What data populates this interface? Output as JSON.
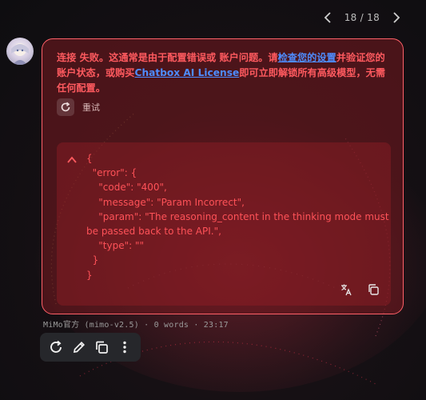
{
  "pager": {
    "text": "18 / 18"
  },
  "error": {
    "line1_pre": "连接 失败。这通常是由于配置错误或 账户问题。请",
    "settings_link": "检查您的设置",
    "line1_post": "并验证您的",
    "line2_pre": "账户状态，或购买",
    "license_link": "Chatbox AI License",
    "line2_post": "即可立即解锁所有高级模型，无需任何配置。",
    "retry_label": "重试"
  },
  "code_block": {
    "content": "{\n  \"error\": {\n    \"code\": \"400\",\n    \"message\": \"Param Incorrect\",\n    \"param\": \"The reasoning_content in the thinking mode must be passed back to the API.\",\n    \"type\": \"\"\n  }\n}"
  },
  "meta": {
    "text": "MiMo官方 (mimo-v2.5) · 0 words · 23:17"
  },
  "colors": {
    "error_text": "#ff5a5f",
    "bubble_border": "#ff6068",
    "link": "#4e8cff",
    "toolbar_bg": "#26272b"
  },
  "icons": {
    "pager": [
      "chevron-left-icon",
      "chevron-right-icon"
    ],
    "code_tools": [
      "translate-icon",
      "copy-icon"
    ],
    "toolbar": [
      "refresh-icon",
      "edit-icon",
      "copy-icon",
      "more-vertical-icon"
    ]
  }
}
